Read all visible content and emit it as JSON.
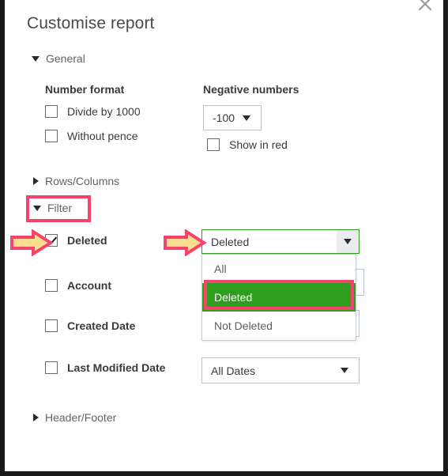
{
  "window": {
    "title": "Customise report",
    "close_icon": "close-x-icon"
  },
  "sections": {
    "general": {
      "label": "General",
      "expanded": true,
      "caret": "caret-down-icon"
    },
    "rows_columns": {
      "label": "Rows/Columns",
      "expanded": false,
      "caret": "caret-right-icon"
    },
    "filter": {
      "label": "Filter",
      "expanded": true,
      "caret": "caret-down-icon"
    },
    "header_footer": {
      "label": "Header/Footer",
      "expanded": false,
      "caret": "caret-right-icon"
    }
  },
  "general": {
    "number_format": {
      "heading": "Number format",
      "options": [
        {
          "label": "Divide by 1000",
          "checked": false
        },
        {
          "label": "Without pence",
          "checked": false
        }
      ]
    },
    "negative_numbers": {
      "heading": "Negative numbers",
      "select_value": "-100",
      "show_in_red": {
        "label": "Show in red",
        "checked": false
      }
    }
  },
  "filter": {
    "rows": [
      {
        "label": "Deleted",
        "checked": true,
        "select_value": "Deleted"
      },
      {
        "label": "Account",
        "checked": false,
        "select_value": ""
      },
      {
        "label": "Created Date",
        "checked": false,
        "select_value": ""
      },
      {
        "label": "Last Modified Date",
        "checked": false,
        "select_value": "All Dates"
      }
    ],
    "open_dropdown": {
      "owner": "Deleted",
      "options": [
        {
          "label": "All",
          "selected": false
        },
        {
          "label": "Deleted",
          "selected": true
        },
        {
          "label": "Not Deleted",
          "selected": false
        }
      ]
    }
  },
  "annotations": {
    "highlight_color": "#f4436c",
    "arrow_fill": "#fadd8f",
    "arrow_stroke": "#f4436c",
    "selected_option_color": "#2f9e1f",
    "boxes": [
      {
        "target": "filter-section-header"
      },
      {
        "target": "deleted-option-in-dropdown"
      }
    ],
    "arrows": [
      {
        "target": "deleted-checkbox"
      },
      {
        "target": "deleted-select"
      }
    ]
  }
}
